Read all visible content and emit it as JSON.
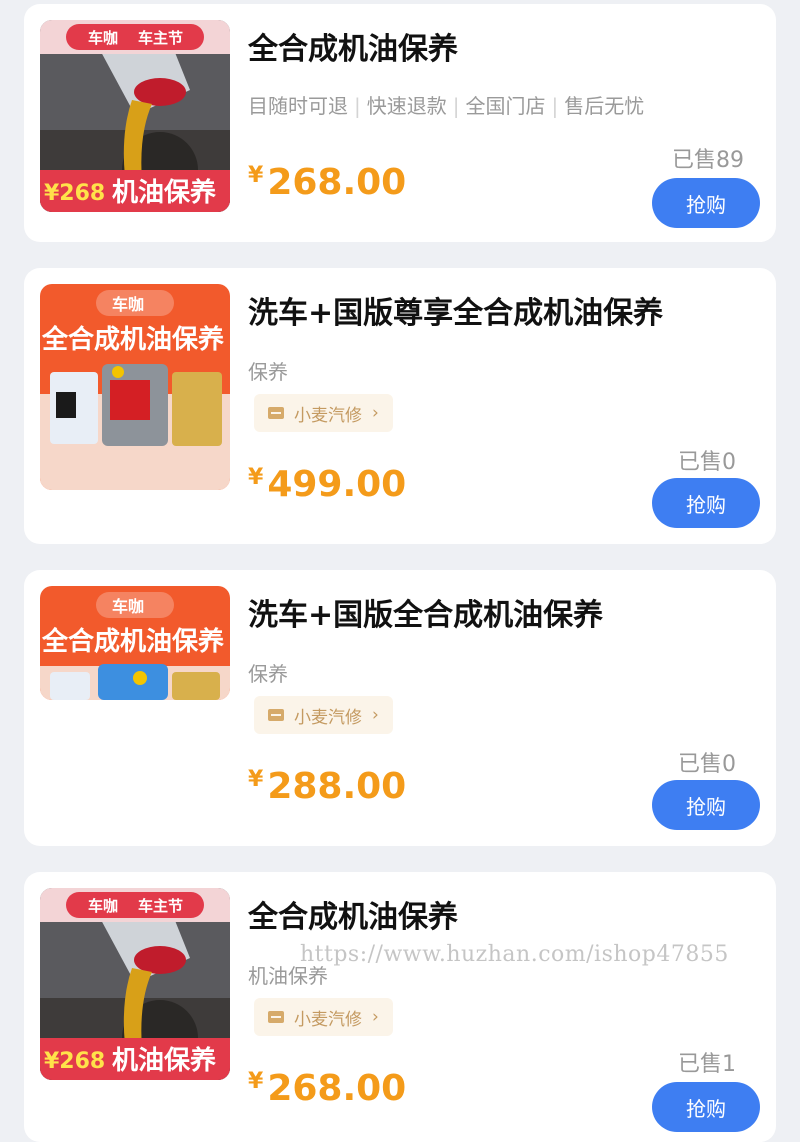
{
  "products": [
    {
      "title": "全合成机油保养",
      "tags": [
        "目随时可退",
        "快速退款",
        "全国门店",
        "售后无忧"
      ],
      "price_symbol": "¥",
      "price": "268.00",
      "sold": "已售89",
      "buy_label": "抢购",
      "image": {
        "brand": "车咖",
        "badge": "车主节",
        "price_badge": "¥268",
        "caption": "机油保养"
      }
    },
    {
      "title": "洗车+国版尊享全合成机油保养",
      "category": "保养",
      "shop": "小麦汽修",
      "price_symbol": "¥",
      "price": "499.00",
      "sold": "已售0",
      "buy_label": "抢购",
      "image": {
        "brand": "车咖",
        "banner": "全合成机油保养"
      }
    },
    {
      "title": "洗车+国版全合成机油保养",
      "category": "保养",
      "shop": "小麦汽修",
      "price_symbol": "¥",
      "price": "288.00",
      "sold": "已售0",
      "buy_label": "抢购",
      "image": {
        "brand": "车咖",
        "banner": "全合成机油保养"
      }
    },
    {
      "title": "全合成机油保养",
      "category": "机油保养",
      "shop": "小麦汽修",
      "price_symbol": "¥",
      "price": "268.00",
      "sold": "已售1",
      "buy_label": "抢购",
      "image": {
        "brand": "车咖",
        "badge": "车主节",
        "price_badge": "¥268",
        "caption": "机油保养"
      }
    }
  ],
  "watermark": "https://www.huzhan.com/ishop47855",
  "colors": {
    "accent": "#3e7ef2",
    "price": "#f49b1a",
    "shop_tag_bg": "#fbf4e9"
  }
}
